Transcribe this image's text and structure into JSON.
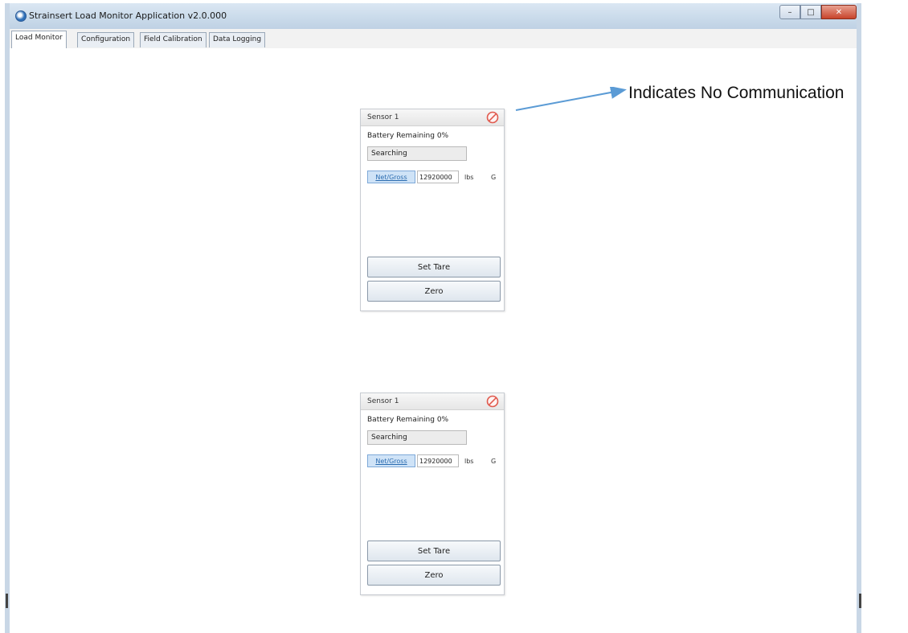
{
  "window": {
    "title": "Strainsert Load Monitor Application v2.0.000",
    "controls": {
      "minimize": "–",
      "maximize": "□",
      "close": "✕"
    }
  },
  "tabs": [
    {
      "label": "Load Monitor",
      "active": true
    },
    {
      "label": "Configuration",
      "active": false
    },
    {
      "label": "Field Calibration",
      "active": false
    },
    {
      "label": "Data Logging",
      "active": false
    }
  ],
  "sensors": [
    {
      "title": "Sensor 1",
      "status_icon": "no-communication-icon",
      "battery": "Battery Remaining 0%",
      "status": "Searching",
      "net_gross_label": "Net/Gross",
      "value": "12920000",
      "unit": "lbs",
      "mode": "G",
      "set_tare_label": "Set Tare",
      "zero_label": "Zero"
    },
    {
      "title": "Sensor 1",
      "status_icon": "no-communication-icon",
      "battery": "Battery Remaining 0%",
      "status": "Searching",
      "net_gross_label": "Net/Gross",
      "value": "12920000",
      "unit": "lbs",
      "mode": "G",
      "set_tare_label": "Set Tare",
      "zero_label": "Zero"
    }
  ],
  "annotation": {
    "text": "Indicates No Communication",
    "arrow_color": "#5b9bd5"
  },
  "colors": {
    "no_comm_icon": "#e05a4e",
    "net_gross_highlight": "#cfe3f7"
  }
}
